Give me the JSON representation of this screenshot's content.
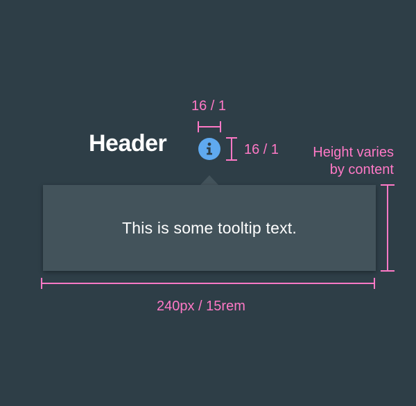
{
  "header": {
    "title": "Header"
  },
  "info_icon": {
    "name": "info-icon",
    "color": "#5fa9ef"
  },
  "tooltip": {
    "text": "This is some tooltip text."
  },
  "dimensions": {
    "icon_width": "16 / 1",
    "icon_height": "16 / 1",
    "height_note_line1": "Height varies",
    "height_note_line2": "by content",
    "tooltip_width": "240px / 15rem"
  },
  "colors": {
    "background": "#2e3e47",
    "tooltip_background": "#43535b",
    "annotation": "#ff79c6",
    "text": "#ffffff"
  }
}
